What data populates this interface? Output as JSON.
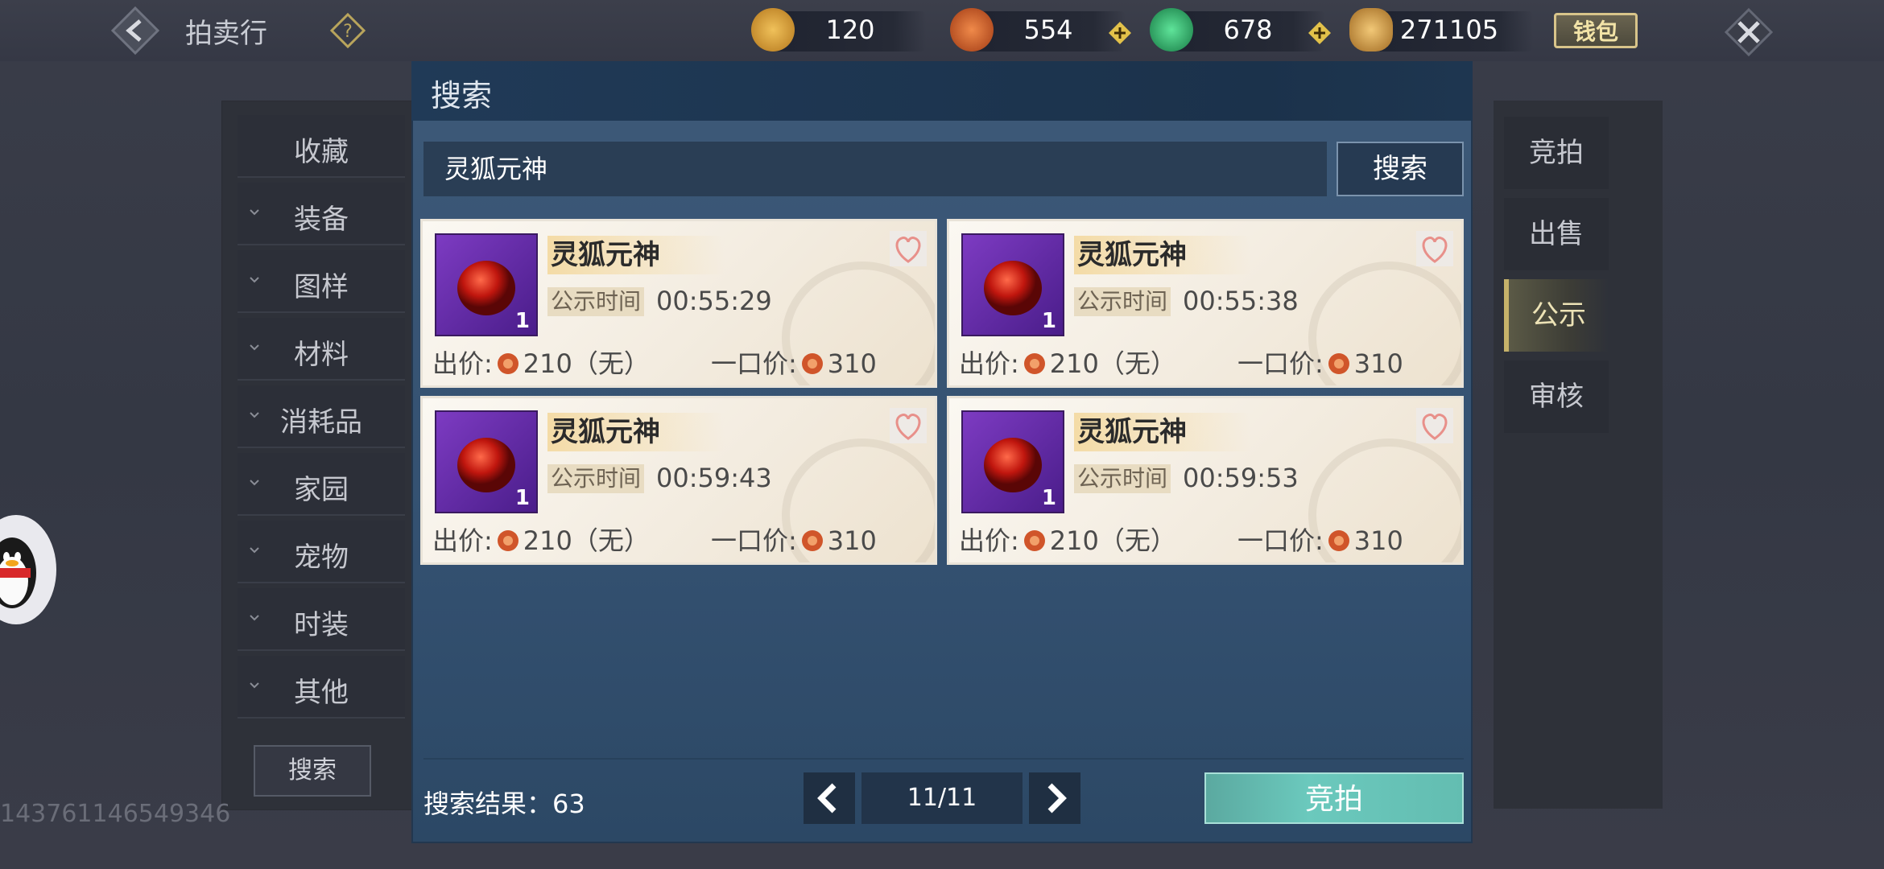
{
  "topbar": {
    "title": "拍卖行",
    "currencies": [
      {
        "name": "bound-gold-icon",
        "value": "120",
        "color": "#e0a23a"
      },
      {
        "name": "red-jade-icon",
        "value": "554",
        "color": "#d05a2a"
      },
      {
        "name": "green-jade-icon",
        "value": "678",
        "color": "#2fb36a"
      },
      {
        "name": "gold-ingot-icon",
        "value": "271105",
        "color": "#d8a348"
      }
    ],
    "wallet_label": "钱包"
  },
  "categories": [
    "收藏",
    "装备",
    "图样",
    "材料",
    "消耗品",
    "家园",
    "宠物",
    "时装",
    "其他"
  ],
  "left_search_label": "搜索",
  "user_id": "143761146549346",
  "right_tabs": [
    "竞拍",
    "出售",
    "公示",
    "审核"
  ],
  "active_tab": "公示",
  "dialog": {
    "title": "搜索",
    "search_value": "灵狐元神",
    "search_button": "搜索",
    "items": [
      {
        "name": "灵狐元神",
        "qty": "1",
        "pub_label": "公示时间",
        "time": "00:55:29",
        "bid_label": "出价:",
        "bid": "210（无）",
        "bin_label": "一口价:",
        "bin": "310"
      },
      {
        "name": "灵狐元神",
        "qty": "1",
        "pub_label": "公示时间",
        "time": "00:55:38",
        "bid_label": "出价:",
        "bid": "210（无）",
        "bin_label": "一口价:",
        "bin": "310"
      },
      {
        "name": "灵狐元神",
        "qty": "1",
        "pub_label": "公示时间",
        "time": "00:59:43",
        "bid_label": "出价:",
        "bid": "210（无）",
        "bin_label": "一口价:",
        "bin": "310"
      },
      {
        "name": "灵狐元神",
        "qty": "1",
        "pub_label": "公示时间",
        "time": "00:59:53",
        "bid_label": "出价:",
        "bid": "210（无）",
        "bin_label": "一口价:",
        "bin": "310"
      }
    ],
    "results_label": "搜索结果：",
    "results_count": "63",
    "page": "11/11",
    "bid_button": "竞拍"
  }
}
